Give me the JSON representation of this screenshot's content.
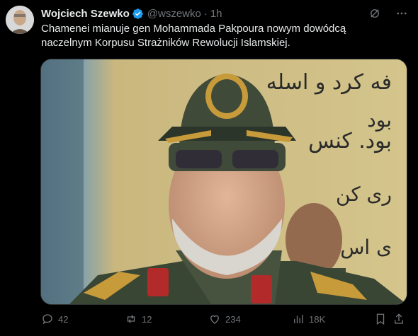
{
  "author": {
    "name": "Wojciech Szewko",
    "handle": "@wszewko",
    "separator": "·",
    "time": "1h",
    "verified_color": "#1d9bf0"
  },
  "post": {
    "text": "Chamenei mianuje gen Mohammada Pakpoura nowym dowódcą\nnaczelnym Korpusu Strażników Rewolucji Islamskiej."
  },
  "media": {
    "background_text_lines": [
      "فه کرد و اسله",
      "بود. کنس",
      "بود",
      "ری کن",
      "ی اس"
    ]
  },
  "actions": {
    "reply_count": "42",
    "repost_count": "12",
    "like_count": "234",
    "views_count": "18K"
  },
  "colors": {
    "background": "#000000",
    "text": "#e7e9ea",
    "muted": "#71767b",
    "accent": "#1d9bf0"
  }
}
